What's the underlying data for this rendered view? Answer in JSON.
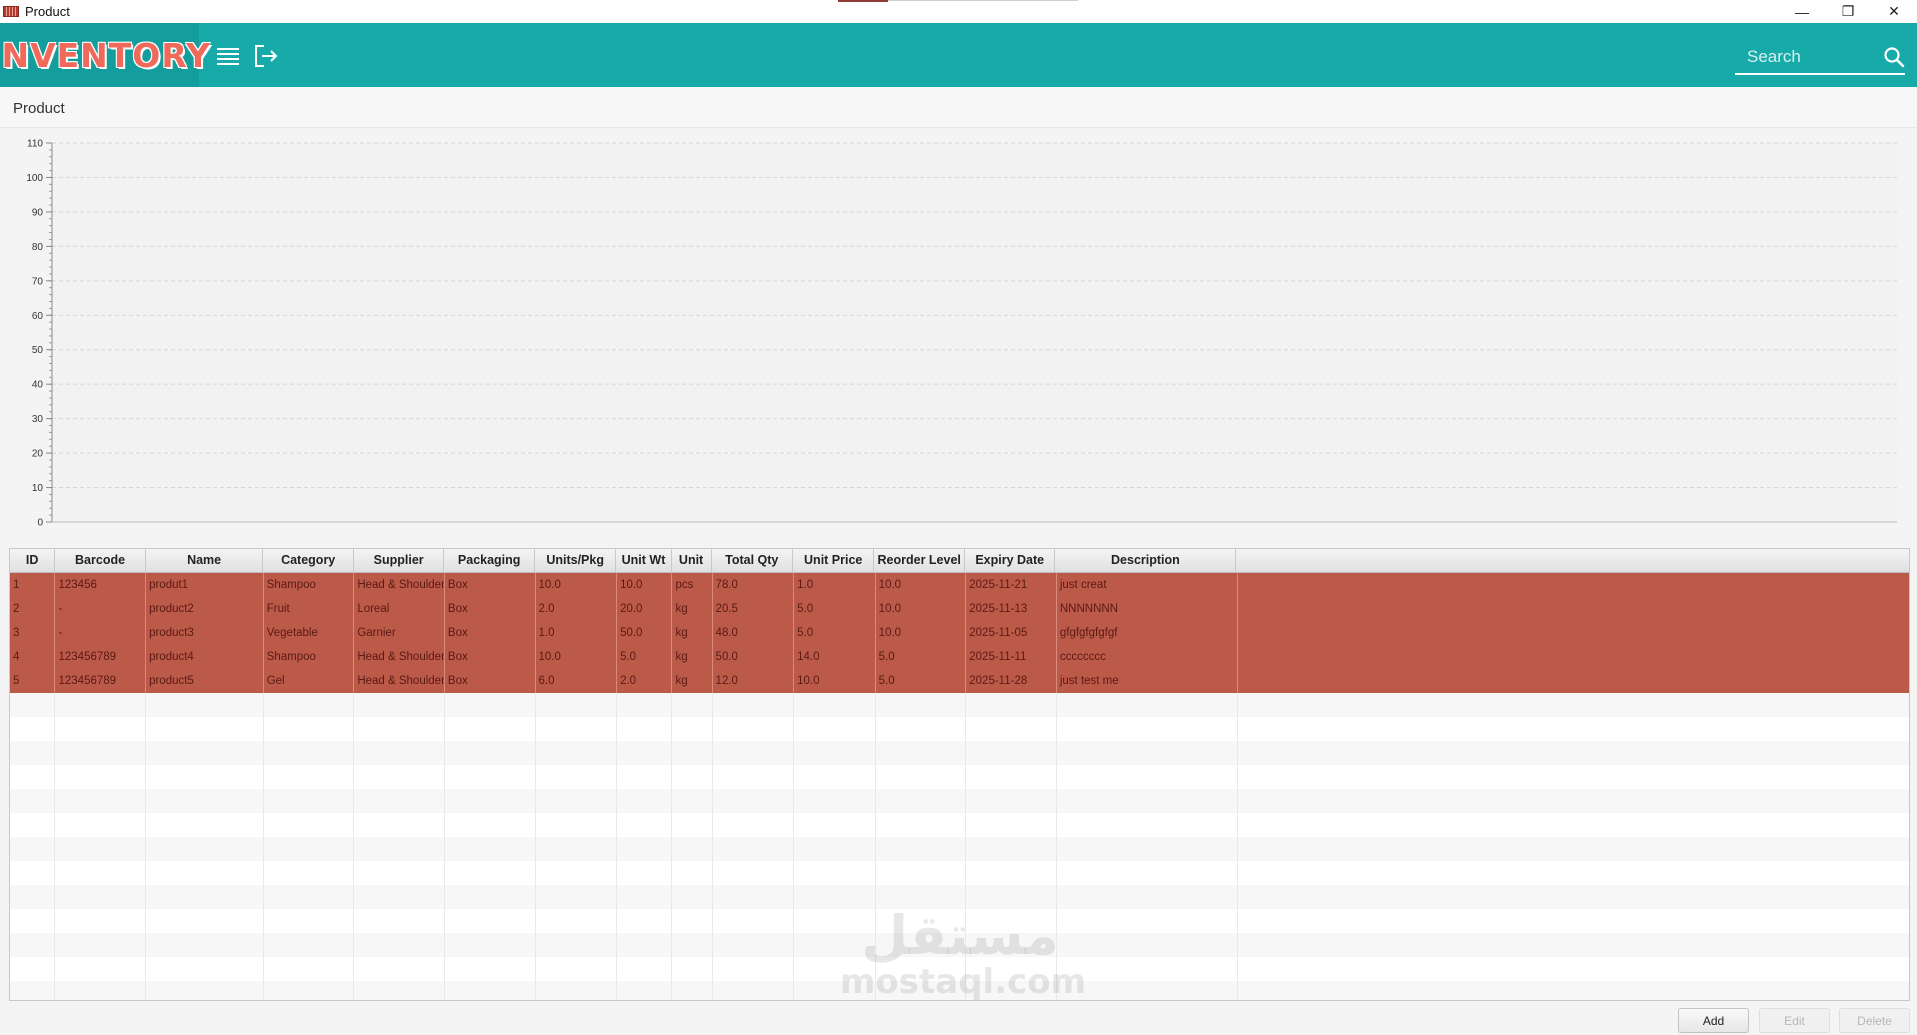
{
  "window": {
    "title": "Product",
    "minimize_glyph": "—",
    "maximize_glyph": "❐",
    "close_glyph": "✕"
  },
  "header": {
    "logo_text": "Inventory",
    "menu_icon": "hamburger-menu-icon",
    "logout_icon": "logout-icon",
    "search_placeholder": "Search",
    "search_value": "",
    "accent_color": "#17aaa9",
    "logo_color": "#f06a5c"
  },
  "breadcrumb": {
    "page_title": "Product"
  },
  "chart_data": {
    "type": "bar",
    "categories": [],
    "series": [],
    "title": "",
    "xlabel": "",
    "ylabel": "",
    "ylim": [
      0,
      110
    ],
    "yticks": [
      0,
      10,
      20,
      30,
      40,
      50,
      60,
      70,
      80,
      90,
      100,
      110
    ],
    "grid": true
  },
  "table": {
    "columns": [
      "ID",
      "Barcode",
      "Name",
      "Category",
      "Supplier",
      "Packaging",
      "Units/Pkg",
      "Unit Wt",
      "Unit",
      "Total Qty",
      "Unit Price",
      "Reorder Level",
      "Expiry Date",
      "Description",
      ""
    ],
    "rows": [
      [
        "1",
        "123456",
        "produt1",
        "Shampoo",
        "Head & Shoulder",
        "Box",
        "10.0",
        "10.0",
        "pcs",
        "78.0",
        "1.0",
        "10.0",
        "2025-11-21",
        "just creat",
        ""
      ],
      [
        "2",
        "-",
        "product2",
        "Fruit",
        "Loreal",
        "Box",
        "2.0",
        "20.0",
        "kg",
        "20.5",
        "5.0",
        "10.0",
        "2025-11-13",
        "NNNNNNN",
        ""
      ],
      [
        "3",
        "-",
        "product3",
        "Vegetable",
        "Garnier",
        "Box",
        "1.0",
        "50.0",
        "kg",
        "48.0",
        "5.0",
        "10.0",
        "2025-11-05",
        "gfgfgfgfgfgf",
        ""
      ],
      [
        "4",
        "123456789",
        "product4",
        "Shampoo",
        "Head & Shoulder",
        "Box",
        "10.0",
        "5.0",
        "kg",
        "50.0",
        "14.0",
        "5.0",
        "2025-11-11",
        "cccccccc",
        ""
      ],
      [
        "5",
        "123456789",
        "product5",
        "Gel",
        "Head & Shoulder",
        "Box",
        "6.0",
        "2.0",
        "kg",
        "12.0",
        "10.0",
        "5.0",
        "2025-11-28",
        "just test me",
        ""
      ]
    ],
    "row_highlight_color": "#bc5a4a",
    "empty_rows": 13
  },
  "watermark": {
    "arabic": "مستقل",
    "latin": "mostaql.com"
  },
  "actions": {
    "add_label": "Add",
    "edit_label": "Edit",
    "delete_label": "Delete"
  }
}
